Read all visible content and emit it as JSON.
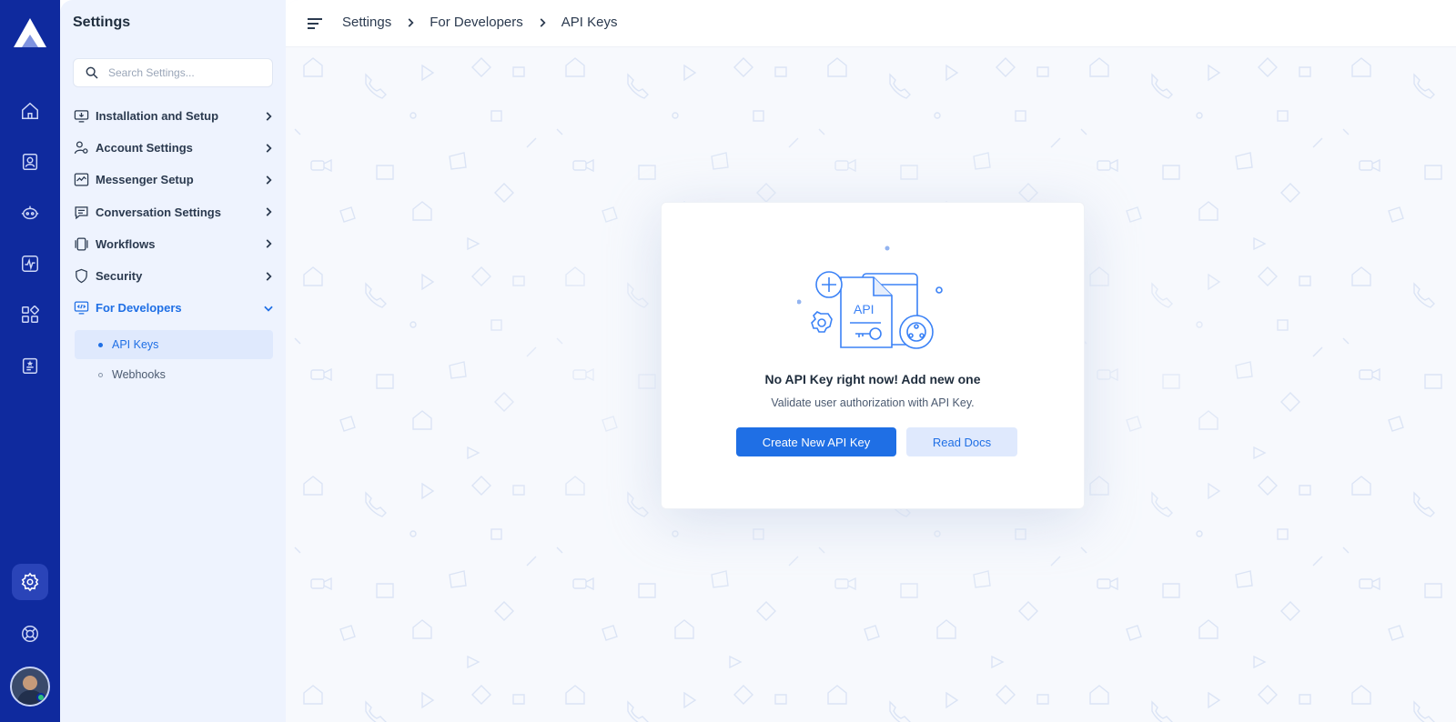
{
  "app": {
    "brand_color": "#0f2a9e",
    "accent_color": "#1f6fe5",
    "rail_icons": [
      "home-icon",
      "contacts-icon",
      "bot-icon",
      "reports-icon",
      "apps-icon",
      "notes-icon",
      "settings-icon",
      "help-icon"
    ]
  },
  "sidebar": {
    "title": "Settings",
    "search_placeholder": "Search Settings...",
    "items": [
      {
        "label": "Installation and Setup",
        "icon": "monitor-download-icon"
      },
      {
        "label": "Account Settings",
        "icon": "user-gear-icon"
      },
      {
        "label": "Messenger Setup",
        "icon": "activity-icon"
      },
      {
        "label": "Conversation Settings",
        "icon": "chat-lines-icon"
      },
      {
        "label": "Workflows",
        "icon": "workflow-icon"
      },
      {
        "label": "Security",
        "icon": "shield-icon"
      },
      {
        "label": "For Developers",
        "icon": "code-monitor-icon"
      }
    ],
    "sub_items": [
      {
        "label": "API Keys",
        "selected": true
      },
      {
        "label": "Webhooks",
        "selected": false
      }
    ]
  },
  "header": {
    "breadcrumb": [
      "Settings",
      "For Developers",
      "API Keys"
    ]
  },
  "empty_state": {
    "illustration_text": "API",
    "heading": "No API Key right now! Add new one",
    "subtext": "Validate user authorization with API Key.",
    "primary_button": "Create New API Key",
    "secondary_button": "Read Docs"
  }
}
